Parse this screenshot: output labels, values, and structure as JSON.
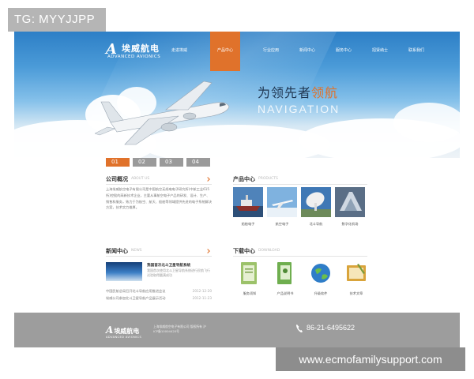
{
  "watermark": {
    "top": "TG: MYYJJPP",
    "bottom": "www.ecmofamilysupport.com"
  },
  "brand": {
    "mark": "A",
    "cn": "埃威航电",
    "en": "ADVANCED AVIONICS"
  },
  "nav": {
    "items": [
      "走进埃威",
      "产品中心",
      "行业应用",
      "新闻中心",
      "服务中心",
      "招贤纳士",
      "联系我们"
    ],
    "active_index": 1
  },
  "hero": {
    "slogan_prefix": "为领先者",
    "slogan_highlight": "领航",
    "slogan_en": "NAVIGATION"
  },
  "slider": {
    "tabs": [
      "01",
      "02",
      "03",
      "04"
    ],
    "active_index": 0
  },
  "company": {
    "title": "公司概况",
    "subtitle": "ABOUT US",
    "text": "上海埃威航空电子有限公司是中国航空无线电电子研究所(中航工业615所)控股的高新技术企业，主要从事航空电子产品的研发、设计、生产、销售和服务，致力于为航空、航天、船舶等领域提供先进的电子系统解决方案，技术实力雄厚。"
  },
  "products": {
    "title": "产品中心",
    "subtitle": "PRODUCTS",
    "items": [
      {
        "label": "船舶电子",
        "icon": "ship-thumb"
      },
      {
        "label": "航空电子",
        "icon": "plane-thumb"
      },
      {
        "label": "北斗导航",
        "icon": "antenna-thumb"
      },
      {
        "label": "数字化机场",
        "icon": "tower-thumb"
      }
    ]
  },
  "news": {
    "title": "新闻中心",
    "subtitle": "NEWS",
    "feature_title": "我国首次北斗卫星导航系统",
    "feature_text": "我国首次使用北斗卫星导航系统进行民航飞行试验取得圆满成功",
    "rows": [
      {
        "text": "中国民航总局召开北斗导航应用推进会议",
        "date": "2012-12-20"
      },
      {
        "text": "埃威公司参加北斗卫星导航产品展示活动",
        "date": "2012-11-23"
      }
    ]
  },
  "downloads": {
    "title": "下载中心",
    "subtitle": "DOWNLOAD",
    "items": [
      {
        "label": "服务须知",
        "icon": "document-icon"
      },
      {
        "label": "产品说明书",
        "icon": "manual-icon"
      },
      {
        "label": "升级软件",
        "icon": "globe-icon"
      },
      {
        "label": "技术文章",
        "icon": "article-icon"
      }
    ]
  },
  "footer": {
    "mark": "A",
    "cn": "埃威航电",
    "en": "ADVANCED AVIONICS",
    "address": "上海埃威航空电子有限公司 版权所有 沪ICP备10004420号",
    "phone": "86-21-6495622"
  },
  "colors": {
    "accent": "#e0722b",
    "footer": "#9d9d9d",
    "tab_inactive": "#9a9a9a"
  }
}
